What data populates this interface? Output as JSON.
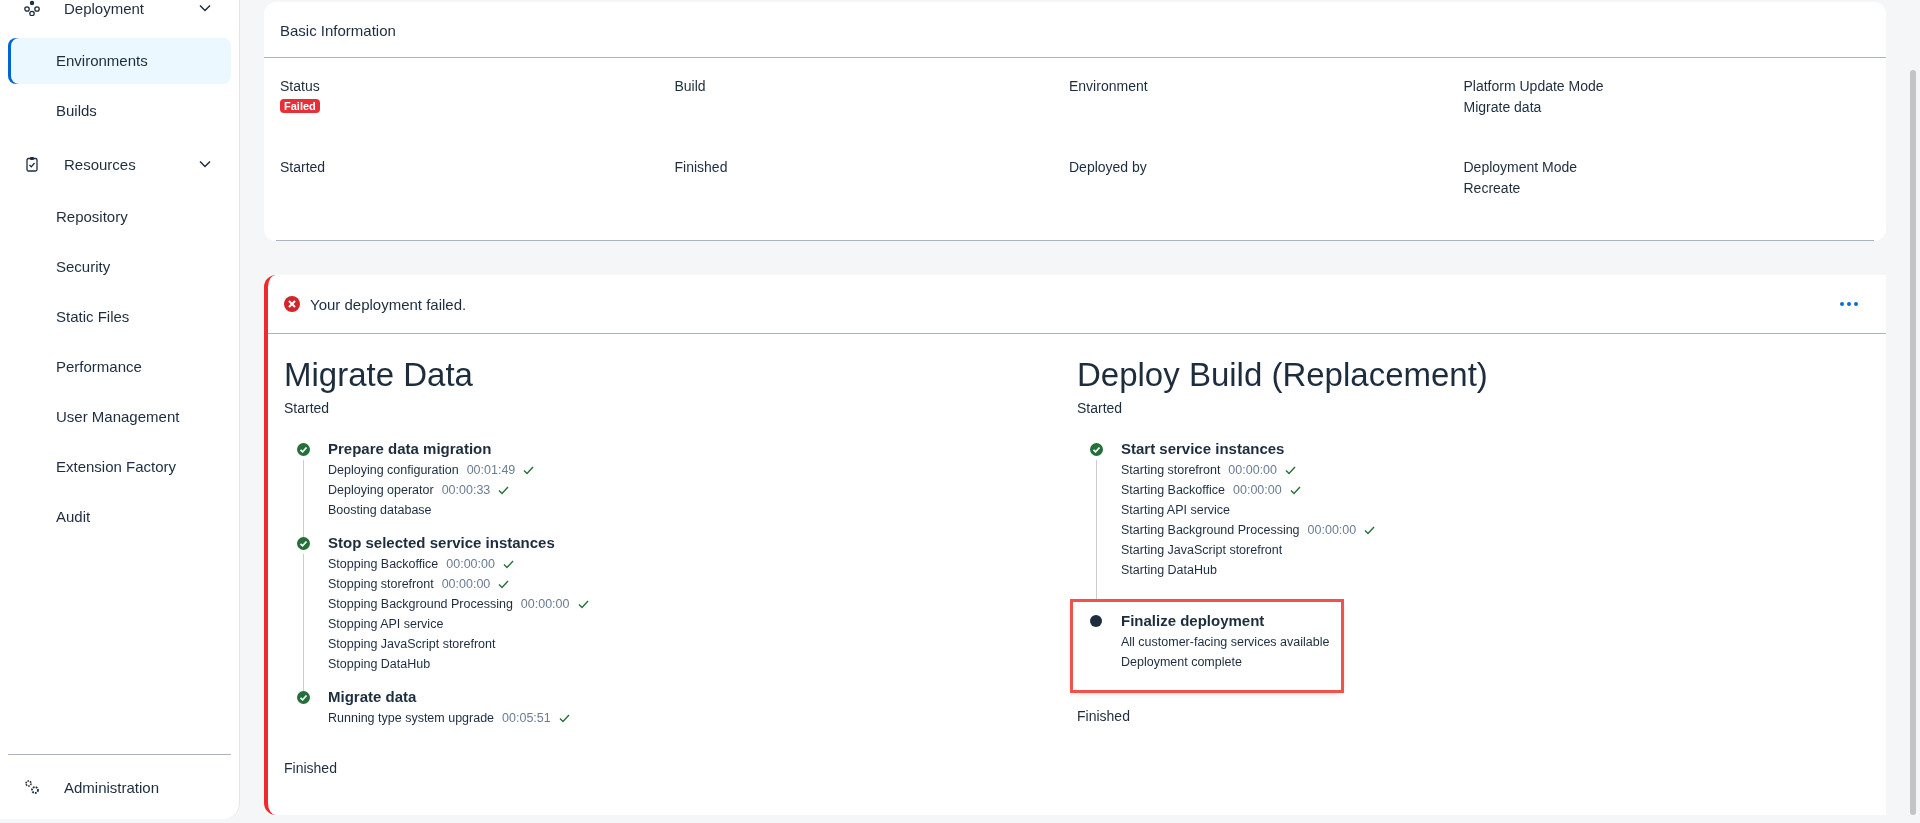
{
  "sidebar": {
    "groups": [
      {
        "label": "Deployment",
        "expanded": true,
        "items": [
          {
            "label": "Environments",
            "selected": true
          },
          {
            "label": "Builds",
            "selected": false
          }
        ]
      },
      {
        "label": "Resources",
        "expanded": true,
        "items": [
          {
            "label": "Repository",
            "selected": false
          },
          {
            "label": "Security",
            "selected": false
          },
          {
            "label": "Static Files",
            "selected": false
          },
          {
            "label": "Performance",
            "selected": false
          },
          {
            "label": "User Management",
            "selected": false
          },
          {
            "label": "Extension Factory",
            "selected": false
          },
          {
            "label": "Audit",
            "selected": false
          }
        ]
      }
    ],
    "footer": {
      "label": "Administration"
    }
  },
  "basic_information": {
    "title": "Basic Information",
    "fields": [
      {
        "label": "Status",
        "value": "Failed",
        "kind": "badge"
      },
      {
        "label": "Build"
      },
      {
        "label": "Environment"
      },
      {
        "label": "Platform Update Mode",
        "value": "Migrate data",
        "kind": "text"
      },
      {
        "label": "Started"
      },
      {
        "label": "Finished"
      },
      {
        "label": "Deployed by"
      },
      {
        "label": "Deployment Mode",
        "value": "Recreate",
        "kind": "text"
      }
    ]
  },
  "deployment": {
    "alert": {
      "message": "Your deployment failed.",
      "kind": "error"
    },
    "phases": [
      {
        "title": "Migrate Data",
        "start_label": "Started",
        "end_label": "Finished",
        "steps": [
          {
            "title": "Prepare data migration",
            "done": true,
            "highlighted": false,
            "tasks": [
              {
                "label": "Deploying configuration",
                "duration": "00:01:49",
                "done": true
              },
              {
                "label": "Deploying operator",
                "duration": "00:00:33",
                "done": true
              },
              {
                "label": "Boosting database",
                "done": false
              }
            ]
          },
          {
            "title": "Stop selected service instances",
            "done": true,
            "highlighted": false,
            "tasks": [
              {
                "label": "Stopping Backoffice",
                "duration": "00:00:00",
                "done": true
              },
              {
                "label": "Stopping storefront",
                "duration": "00:00:00",
                "done": true
              },
              {
                "label": "Stopping Background Processing",
                "duration": "00:00:00",
                "done": true
              },
              {
                "label": "Stopping API service",
                "done": false
              },
              {
                "label": "Stopping JavaScript storefront",
                "done": false
              },
              {
                "label": "Stopping DataHub",
                "done": false
              }
            ]
          },
          {
            "title": "Migrate data",
            "done": true,
            "highlighted": false,
            "tasks": [
              {
                "label": "Running type system upgrade",
                "duration": "00:05:51",
                "done": true
              }
            ]
          }
        ]
      },
      {
        "title": "Deploy Build (Replacement)",
        "start_label": "Started",
        "end_label": "Finished",
        "steps": [
          {
            "title": "Start service instances",
            "done": true,
            "highlighted": false,
            "tasks": [
              {
                "label": "Starting storefront",
                "duration": "00:00:00",
                "done": true
              },
              {
                "label": "Starting Backoffice",
                "duration": "00:00:00",
                "done": true
              },
              {
                "label": "Starting API service",
                "done": false
              },
              {
                "label": "Starting Background Processing",
                "duration": "00:00:00",
                "done": true
              },
              {
                "label": "Starting JavaScript storefront",
                "done": false
              },
              {
                "label": "Starting DataHub",
                "done": false
              }
            ]
          },
          {
            "title": "Finalize deployment",
            "done": false,
            "highlighted": true,
            "tasks": [
              {
                "label": "All customer-facing services available",
                "done": false
              },
              {
                "label": "Deployment complete",
                "done": false
              }
            ]
          }
        ]
      }
    ]
  }
}
